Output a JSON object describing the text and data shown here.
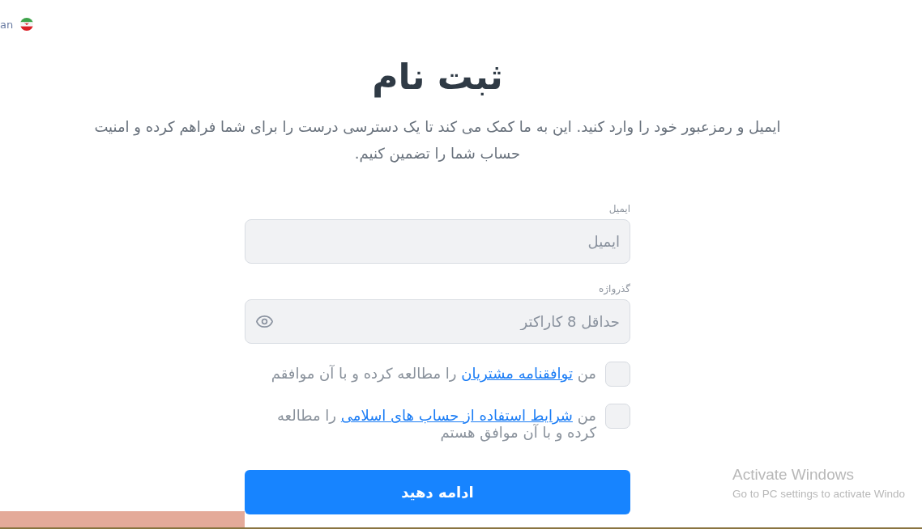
{
  "language": {
    "label": "an"
  },
  "title": "ثبت نام",
  "subtitle": "ایمیل و رمزعبور خود را وارد کنید. این به ما کمک می کند تا یک دسترسی درست را برای شما فراهم کرده و امنیت حساب شما را تضمین کنیم.",
  "fields": [
    {
      "kind": "email",
      "label": "ایمیل",
      "placeholder": "ایمیل"
    },
    {
      "kind": "password",
      "label": "گذرواژه",
      "placeholder": "حداقل 8 کاراکتر"
    }
  ],
  "agreements": [
    {
      "checked": false,
      "before": "من ",
      "link": "توافقنامه مشتریان",
      "after": " را مطالعه کرده و با آن موافقم"
    },
    {
      "checked": false,
      "before": "من ",
      "link": "شرایط استفاده از حساب های اسلامی",
      "after": " را مطالعه کرده و با آن موافق هستم"
    }
  ],
  "submit_button": "ادامه دهید",
  "os_notice": {
    "title": "Activate Windows",
    "text": "Go to PC settings to activate Windo"
  }
}
